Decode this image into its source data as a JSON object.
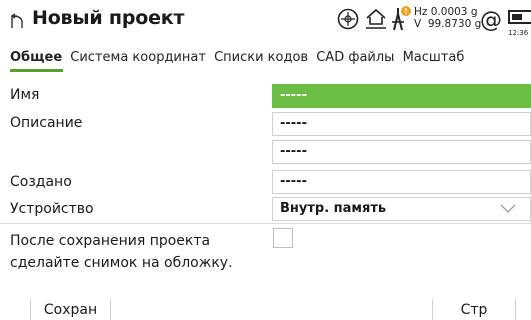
{
  "header": {
    "title": "Новый проект",
    "hz": "Hz 0.0003 g",
    "v": "V  99.8730 g",
    "clock": "12:36",
    "icons": [
      "back-icon",
      "target-icon",
      "home-level-icon",
      "prism-alert-icon",
      "at-icon",
      "battery-icon"
    ]
  },
  "tabs": [
    {
      "label": "Общее",
      "active": true
    },
    {
      "label": "Система координат",
      "active": false
    },
    {
      "label": "Списки кодов",
      "active": false
    },
    {
      "label": "CAD файлы",
      "active": false
    },
    {
      "label": "Масштаб",
      "active": false
    }
  ],
  "form": {
    "name_label": "Имя",
    "name_value": "-----",
    "description_label": "Описание",
    "description_value_1": "-----",
    "description_value_2": "-----",
    "created_label": "Создано",
    "created_value": "-----",
    "device_label": "Устройство",
    "device_value": "Внутр. память",
    "photo_label_line1": "После сохранения проекта",
    "photo_label_line2": "сделайте снимок на обложку.",
    "photo_checked": false
  },
  "softkeys": {
    "save": "Сохран",
    "page": "Стр"
  },
  "colors": {
    "accent": "#6cbd45",
    "tab_underline": "#5aa02c",
    "alert": "#f0a020"
  }
}
